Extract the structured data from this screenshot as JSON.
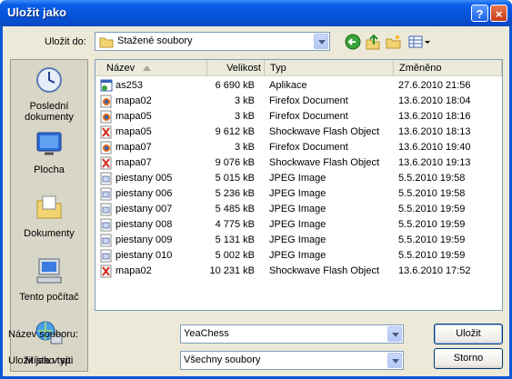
{
  "window": {
    "title": "Uložit jako",
    "help_glyph": "?",
    "close_glyph": "×"
  },
  "toolbar": {
    "save_in_label": "Uložit do:",
    "current_folder": "Stažené soubory",
    "icons": [
      "back-icon",
      "up-folder-icon",
      "new-folder-icon",
      "view-menu-icon"
    ]
  },
  "places": [
    {
      "label_lines": [
        "Poslední",
        "dokumenty"
      ],
      "icon": "recent-documents-icon"
    },
    {
      "label_lines": [
        "Plocha"
      ],
      "icon": "desktop-icon"
    },
    {
      "label_lines": [
        "Dokumenty"
      ],
      "icon": "documents-icon"
    },
    {
      "label_lines": [
        "Tento počítač"
      ],
      "icon": "my-computer-icon"
    },
    {
      "label_lines": [
        "Místa v síti"
      ],
      "icon": "network-places-icon"
    }
  ],
  "columns": {
    "name": "Název",
    "size": "Velikost",
    "type": "Typ",
    "modified": "Změněno"
  },
  "files": [
    {
      "name": "as253",
      "size": "6 690 kB",
      "type": "Aplikace",
      "modified": "27.6.2010 21:56",
      "icon": "application-icon"
    },
    {
      "name": "mapa02",
      "size": "3 kB",
      "type": "Firefox Document",
      "modified": "13.6.2010 18:04",
      "icon": "firefox-document-icon"
    },
    {
      "name": "mapa05",
      "size": "3 kB",
      "type": "Firefox Document",
      "modified": "13.6.2010 18:16",
      "icon": "firefox-document-icon"
    },
    {
      "name": "mapa05",
      "size": "9 612 kB",
      "type": "Shockwave Flash Object",
      "modified": "13.6.2010 18:13",
      "icon": "flash-icon"
    },
    {
      "name": "mapa07",
      "size": "3 kB",
      "type": "Firefox Document",
      "modified": "13.6.2010 19:40",
      "icon": "firefox-document-icon"
    },
    {
      "name": "mapa07",
      "size": "9 076 kB",
      "type": "Shockwave Flash Object",
      "modified": "13.6.2010 19:13",
      "icon": "flash-icon"
    },
    {
      "name": "piestany 005",
      "size": "5 015 kB",
      "type": "JPEG Image",
      "modified": "5.5.2010 19:58",
      "icon": "jpeg-icon"
    },
    {
      "name": "piestany 006",
      "size": "5 236 kB",
      "type": "JPEG Image",
      "modified": "5.5.2010 19:58",
      "icon": "jpeg-icon"
    },
    {
      "name": "piestany 007",
      "size": "5 485 kB",
      "type": "JPEG Image",
      "modified": "5.5.2010 19:59",
      "icon": "jpeg-icon"
    },
    {
      "name": "piestany 008",
      "size": "4 775 kB",
      "type": "JPEG Image",
      "modified": "5.5.2010 19:59",
      "icon": "jpeg-icon"
    },
    {
      "name": "piestany 009",
      "size": "5 131 kB",
      "type": "JPEG Image",
      "modified": "5.5.2010 19:59",
      "icon": "jpeg-icon"
    },
    {
      "name": "piestany 010",
      "size": "5 002 kB",
      "type": "JPEG Image",
      "modified": "5.5.2010 19:59",
      "icon": "jpeg-icon"
    },
    {
      "name": "mapa02",
      "size": "10 231 kB",
      "type": "Shockwave Flash Object",
      "modified": "13.6.2010 17:52",
      "icon": "flash-icon"
    }
  ],
  "footer": {
    "filename_label": "Název souboru:",
    "filename_value": "YeaChess",
    "filetype_label": "Uložit jako typ:",
    "filetype_value": "Všechny soubory",
    "save_button": "Uložit",
    "cancel_button": "Storno"
  },
  "colors": {
    "titlebar": "#0553d9",
    "dialog_bg": "#ece9d8",
    "list_border": "#7f9db9"
  }
}
